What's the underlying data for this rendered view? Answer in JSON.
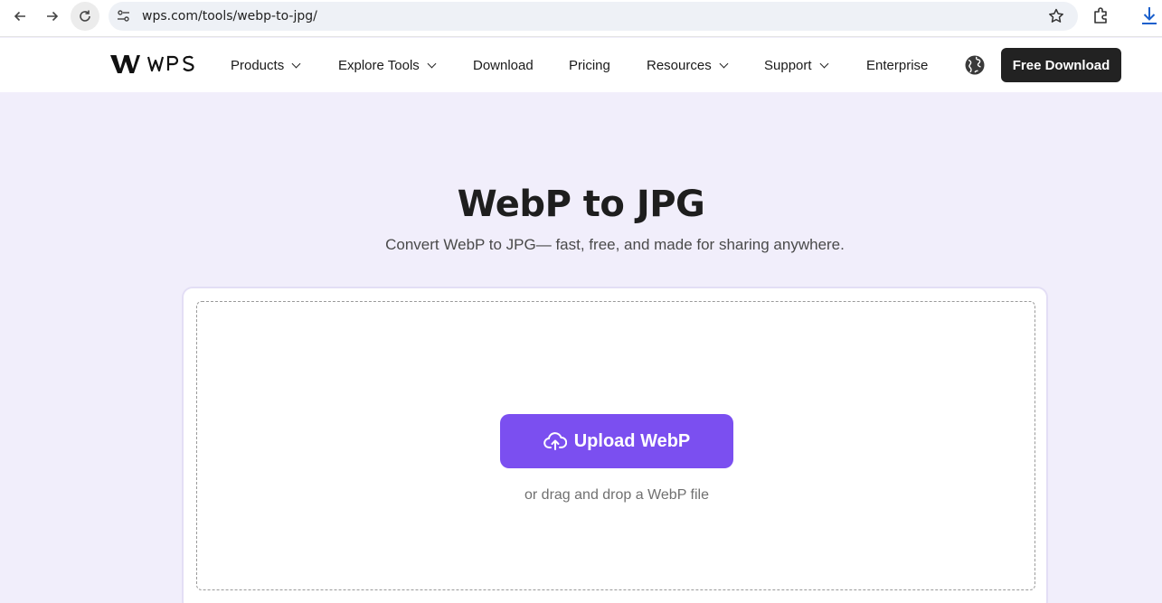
{
  "browser": {
    "url": "wps.com/tools/webp-to-jpg/",
    "icons": [
      "back-arrow-icon",
      "forward-arrow-icon",
      "reload-icon",
      "site-settings-icon",
      "bookmark-star-icon",
      "extensions-icon",
      "download-icon"
    ]
  },
  "header": {
    "logo_text": "WPS",
    "nav": [
      {
        "label": "Products",
        "has_dropdown": true
      },
      {
        "label": "Explore Tools",
        "has_dropdown": true
      },
      {
        "label": "Download",
        "has_dropdown": false
      },
      {
        "label": "Pricing",
        "has_dropdown": false
      },
      {
        "label": "Resources",
        "has_dropdown": true
      },
      {
        "label": "Support",
        "has_dropdown": true
      },
      {
        "label": "Enterprise",
        "has_dropdown": false
      }
    ],
    "cta_label": "Free Download"
  },
  "hero": {
    "title": "WebP to JPG",
    "subtitle": "Convert WebP to JPG— fast, free, and made for sharing anywhere."
  },
  "upload": {
    "button_label": "Upload WebP",
    "drag_text": "or drag and drop a WebP file"
  },
  "colors": {
    "accent": "#7b4ff0",
    "page_bg": "#f1eefb",
    "cta_bg": "#222222"
  }
}
